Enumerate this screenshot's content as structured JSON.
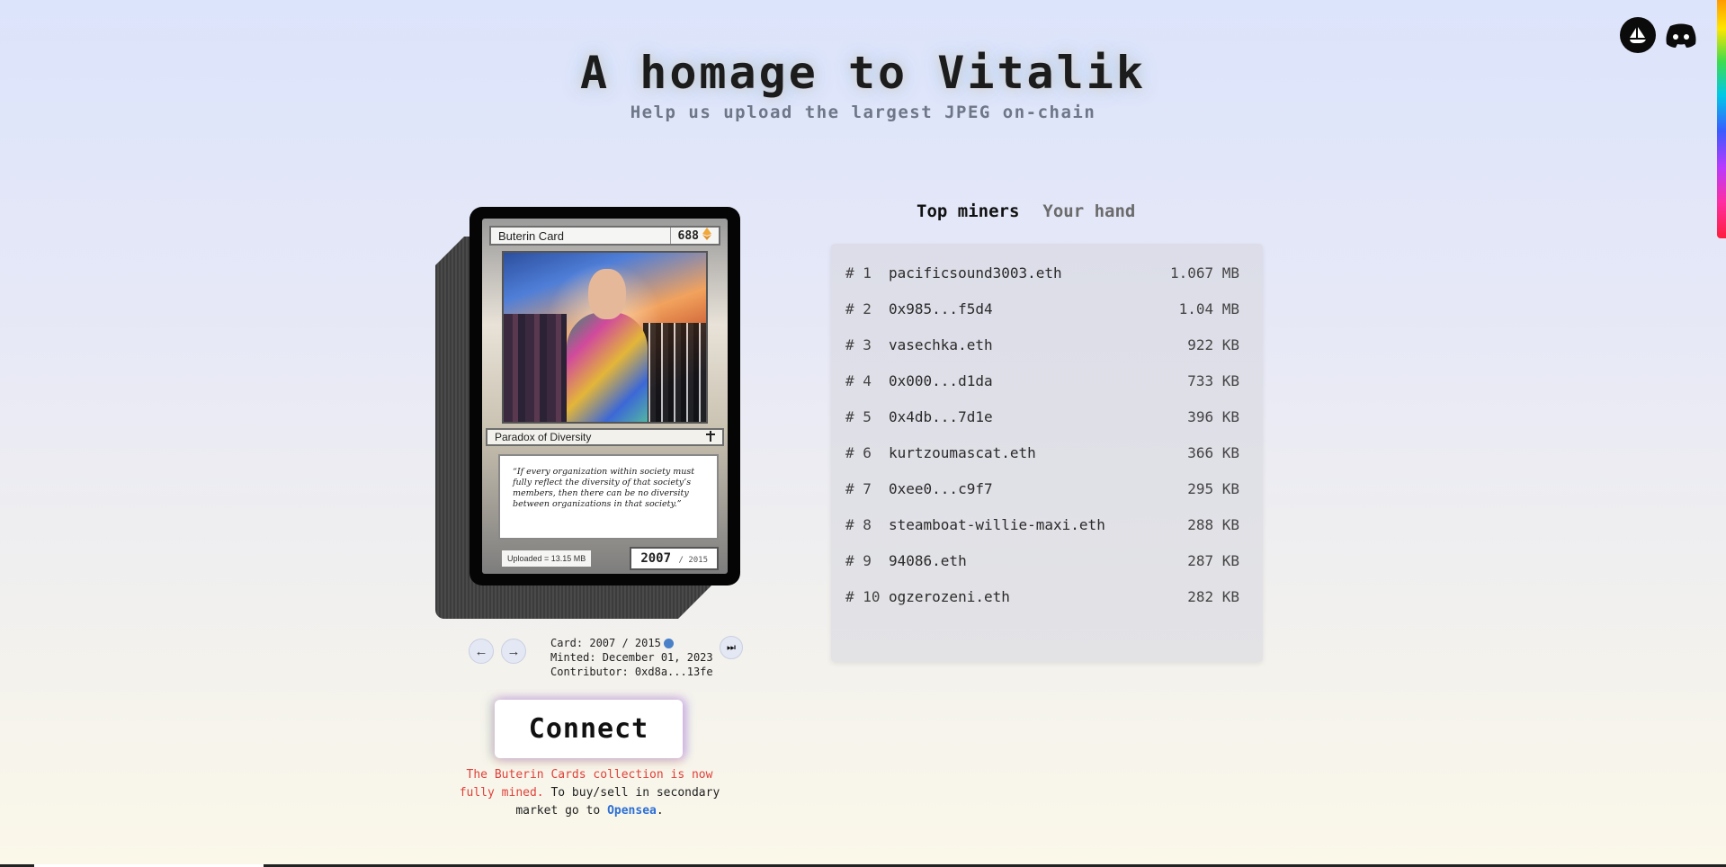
{
  "header": {
    "title": "A homage to Vitalik",
    "subtitle": "Help us upload the largest JPEG on-chain"
  },
  "social": {
    "icons": [
      "opensea-icon",
      "discord-icon"
    ]
  },
  "card": {
    "name": "Buterin Card",
    "cost": "688",
    "type_line": "Paradox of Diversity",
    "quote": "“If every organization within society must fully reflect the diversity of that society’s members, then there can be no diversity between organizations in that society.”",
    "uploaded": "Uploaded = 13.15 MB",
    "number": "2007",
    "total": "/ 2015"
  },
  "card_info": {
    "card": "Card: 2007 / 2015",
    "minted": "Minted: December 01, 2023",
    "contributor": "Contributor: 0xd8a...13fe"
  },
  "nav": {
    "prev_icon": "←",
    "next_icon": "→",
    "skip_icon": "⏭"
  },
  "connect_label": "Connect",
  "notice": {
    "red": "The Buterin Cards collection is now fully mined.",
    "normal": " To buy/sell in secondary market go to ",
    "link": "Opensea",
    "end": "."
  },
  "tabs": [
    "Top miners",
    "Your hand"
  ],
  "leaderboard": [
    {
      "rank": "# 1",
      "name": "pacificsound3003.eth",
      "size": "1.067 MB"
    },
    {
      "rank": "# 2",
      "name": "0x985...f5d4",
      "size": "1.04 MB"
    },
    {
      "rank": "# 3",
      "name": "vasechka.eth",
      "size": "922 KB"
    },
    {
      "rank": "# 4",
      "name": "0x000...d1da",
      "size": "733 KB"
    },
    {
      "rank": "# 5",
      "name": "0x4db...7d1e",
      "size": "396 KB"
    },
    {
      "rank": "# 6",
      "name": "kurtzoumascat.eth",
      "size": "366 KB"
    },
    {
      "rank": "# 7",
      "name": "0xee0...c9f7",
      "size": "295 KB"
    },
    {
      "rank": "# 8",
      "name": "steamboat-willie-maxi.eth",
      "size": "288 KB"
    },
    {
      "rank": "# 9",
      "name": "94086.eth",
      "size": "287 KB"
    },
    {
      "rank": "# 10",
      "name": "ogzerozeni.eth",
      "size": "282 KB"
    }
  ],
  "colors": {
    "accent_link": "#2c6fd6",
    "notice_red": "#e0413a"
  }
}
